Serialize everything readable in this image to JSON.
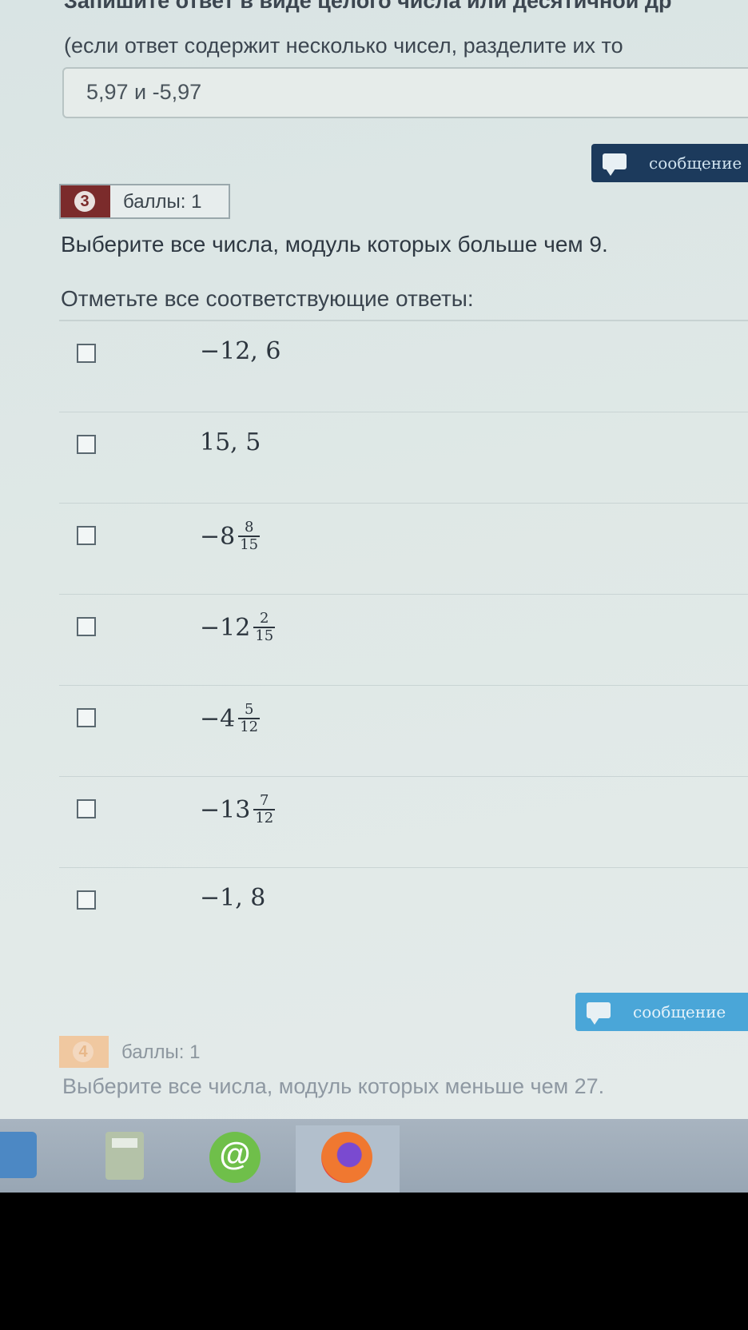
{
  "prev_question": {
    "instruction_line1": "Запишите ответ в виде целого числа или десятичной др",
    "instruction_line2": "(если ответ содержит несколько чисел, разделите их то",
    "answer_value": "5,97 и -5,97"
  },
  "message_button_label": "сообщение",
  "question3": {
    "number": "3",
    "points": "баллы: 1",
    "text": "Выберите все числа, модуль которых больше чем 9.",
    "subtext": "Отметьте все соответствующие ответы:",
    "options": [
      {
        "whole": "−12, 6",
        "num": "",
        "den": "",
        "checked": false
      },
      {
        "whole": "15, 5",
        "num": "",
        "den": "",
        "checked": false
      },
      {
        "whole": "−8",
        "num": "8",
        "den": "15",
        "checked": false
      },
      {
        "whole": "−12",
        "num": "2",
        "den": "15",
        "checked": false
      },
      {
        "whole": "−4",
        "num": "5",
        "den": "12",
        "checked": false
      },
      {
        "whole": "−13",
        "num": "7",
        "den": "12",
        "checked": false
      },
      {
        "whole": "−1, 8",
        "num": "",
        "den": "",
        "checked": false
      }
    ]
  },
  "question4": {
    "number": "4",
    "points": "баллы: 1",
    "text": "Выберите все числа, модуль которых меньше чем 27."
  },
  "taskbar": {
    "icons": [
      "settings-icon",
      "calculator-icon",
      "mail-agent-icon",
      "firefox-icon"
    ]
  }
}
